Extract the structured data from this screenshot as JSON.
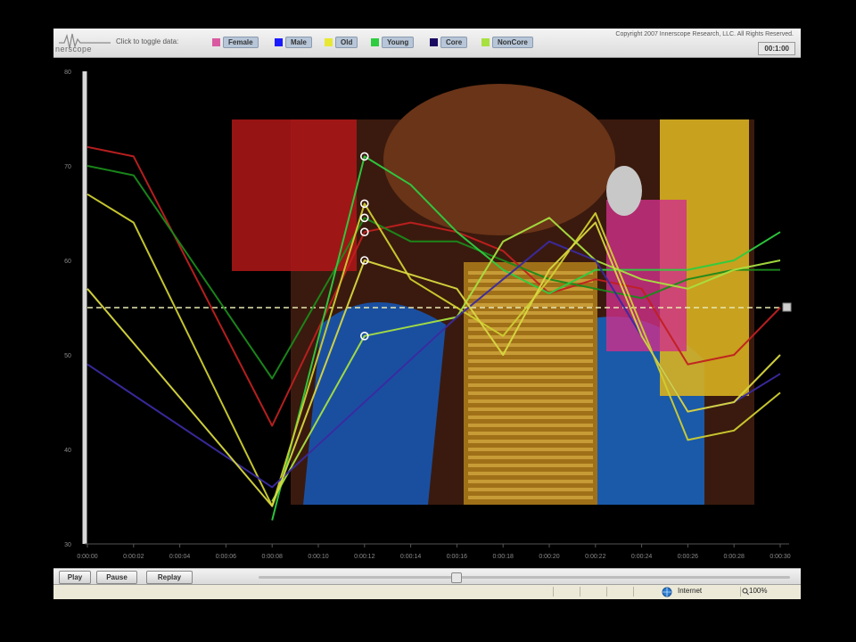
{
  "logo": {
    "text": "nerscope",
    "icon": "waveform-logo-icon"
  },
  "toolbar": {
    "toggle_label": "Click to toggle data:",
    "toggles": [
      {
        "label": "Female",
        "color": "#d95aa0"
      },
      {
        "label": "Male",
        "color": "#1a1aff"
      },
      {
        "label": "Old",
        "color": "#e8e834"
      },
      {
        "label": "Young",
        "color": "#2ecc40"
      },
      {
        "label": "Core",
        "color": "#1a0a60"
      },
      {
        "label": "NonCore",
        "color": "#a8e040"
      }
    ],
    "copyright": "Copyright 2007 Innerscope Research, LLC. All Rights Reserved.",
    "time": "00:1:00"
  },
  "chart_data": {
    "type": "line",
    "x": [
      "0:00:00",
      "0:00:02",
      "0:00:04",
      "0:00:06",
      "0:00:08",
      "0:00:10",
      "0:00:12",
      "0:00:14",
      "0:00:16",
      "0:00:18",
      "0:00:20",
      "0:00:22",
      "0:00:24",
      "0:00:26",
      "0:00:28",
      "0:00:30"
    ],
    "ylim": [
      30,
      80
    ],
    "yticks": [
      30,
      40,
      50,
      60,
      70,
      80
    ],
    "reference_line": 55,
    "playhead": "0:00:12",
    "series": [
      {
        "color": "#c02020",
        "values": [
          72,
          71,
          null,
          null,
          42.5,
          null,
          63,
          64,
          63,
          61,
          56.5,
          58,
          57,
          49,
          50,
          55
        ]
      },
      {
        "color": "#1a8a1a",
        "values": [
          70,
          69,
          null,
          null,
          47.5,
          null,
          64.5,
          62,
          62,
          60,
          58,
          57,
          56,
          58,
          59,
          59
        ]
      },
      {
        "color": "#2ecc40",
        "values": [
          null,
          null,
          null,
          null,
          32.5,
          null,
          71,
          68,
          63,
          59,
          56.5,
          59,
          59,
          59,
          60,
          63
        ]
      },
      {
        "color": "#cfcf30",
        "values": [
          67,
          64,
          null,
          null,
          34,
          null,
          66,
          58,
          55,
          52,
          58,
          65,
          53,
          41,
          42,
          46
        ]
      },
      {
        "color": "#a8e040",
        "values": [
          null,
          null,
          null,
          null,
          34.5,
          null,
          52,
          53,
          54,
          62,
          64.5,
          60,
          58,
          57,
          59,
          60
        ]
      },
      {
        "color": "#3a2aa0",
        "values": [
          49,
          null,
          null,
          null,
          36,
          null,
          null,
          null,
          54,
          58,
          62,
          60,
          52,
          44,
          45,
          48
        ]
      },
      {
        "color": "#d8d840",
        "values": [
          57,
          null,
          null,
          null,
          34,
          null,
          60,
          null,
          57,
          50,
          59,
          64,
          52,
          44,
          45,
          50
        ]
      }
    ]
  },
  "controls": {
    "play": "Play",
    "pause": "Pause",
    "replay": "Replay"
  },
  "status": {
    "zone": "Internet",
    "zoom": "100%"
  }
}
